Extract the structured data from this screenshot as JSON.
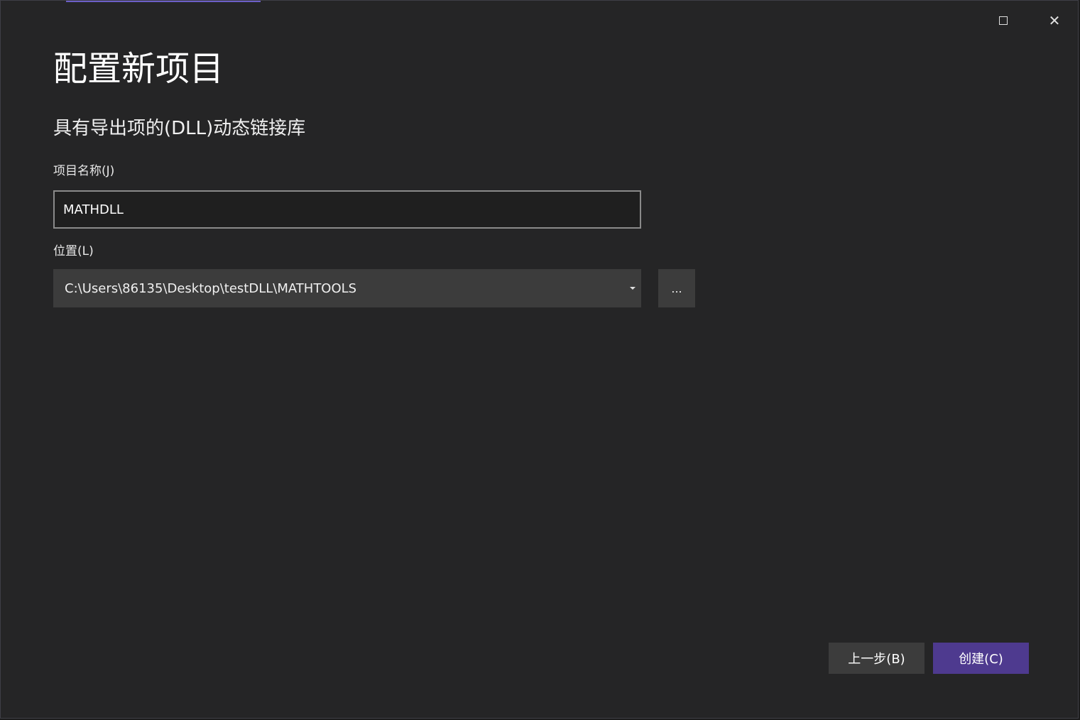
{
  "window": {
    "maximize_icon": "maximize-icon",
    "close_icon": "close-icon",
    "close_glyph": "✕"
  },
  "page": {
    "title": "配置新项目",
    "template_name": "具有导出项的(DLL)动态链接库"
  },
  "project_name": {
    "label": "项目名称(J)",
    "value": "MATHDLL"
  },
  "location": {
    "label": "位置(L)",
    "value": "C:\\Users\\86135\\Desktop\\testDLL\\MATHTOOLS",
    "browse_label": "..."
  },
  "footer": {
    "back_label": "上一步(B)",
    "create_label": "创建(C)"
  },
  "colors": {
    "background": "#252526",
    "accent": "#4e3a8f",
    "input_border": "#8a8a8a"
  }
}
